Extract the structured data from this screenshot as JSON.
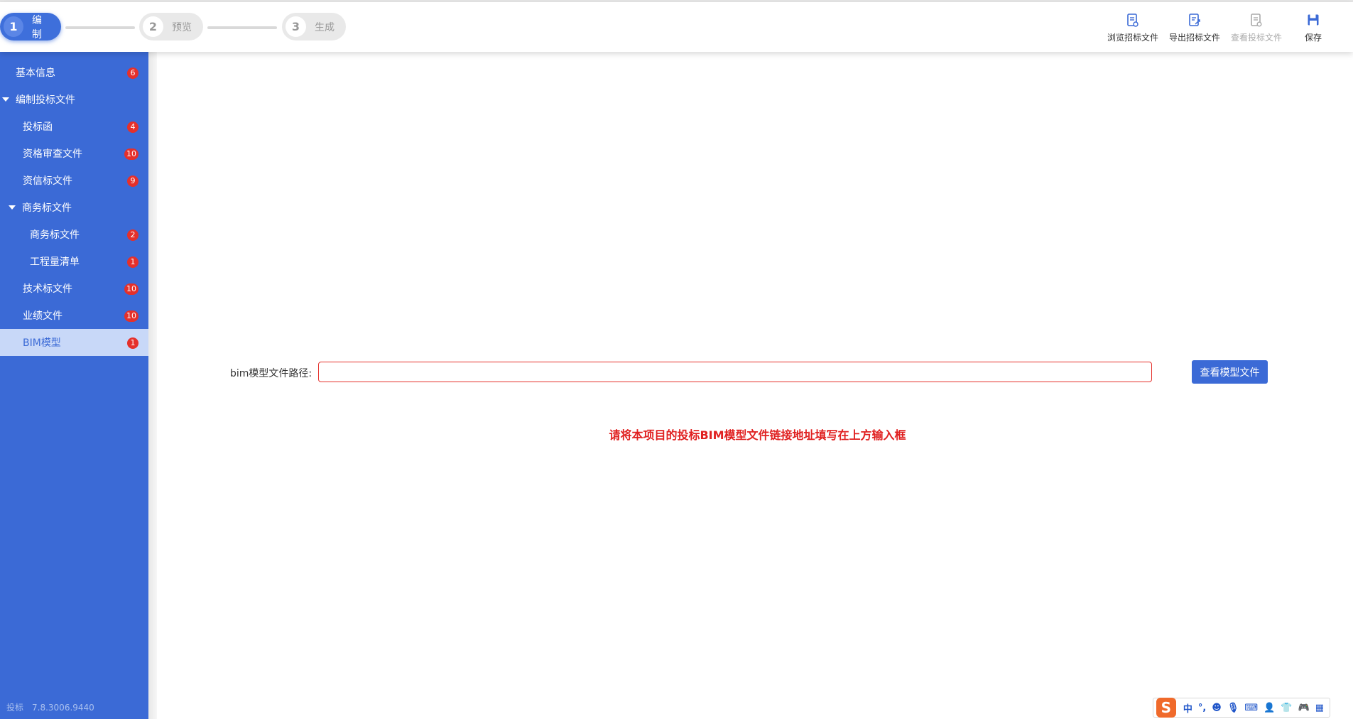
{
  "steps": [
    {
      "num": "1",
      "label": "编制",
      "active": true
    },
    {
      "num": "2",
      "label": "预览",
      "active": false
    },
    {
      "num": "3",
      "label": "生成",
      "active": false
    }
  ],
  "toolbar": {
    "browse": "浏览招标文件",
    "export": "导出招标文件",
    "view_bid": "查看投标文件",
    "save": "保存"
  },
  "sidebar": {
    "items": [
      {
        "label": "基本信息",
        "badge": "6"
      },
      {
        "label": "编制投标文件"
      },
      {
        "label": "投标函",
        "badge": "4"
      },
      {
        "label": "资格审查文件",
        "badge": "10"
      },
      {
        "label": "资信标文件",
        "badge": "9"
      },
      {
        "label": "商务标文件"
      },
      {
        "label": "商务标文件",
        "badge": "2"
      },
      {
        "label": "工程量清单",
        "badge": "1"
      },
      {
        "label": "技术标文件",
        "badge": "10"
      },
      {
        "label": "业绩文件",
        "badge": "10"
      },
      {
        "label": "BIM模型",
        "badge": "1"
      }
    ],
    "version_label": "投标",
    "version": "7.8.3006.9440"
  },
  "form": {
    "path_label": "bim模型文件路径:",
    "path_value": "",
    "view_button": "查看模型文件",
    "hint": "请将本项目的投标BIM模型文件链接地址填写在上方输入框"
  },
  "ime": {
    "mode": "中",
    "punct": "°,"
  }
}
